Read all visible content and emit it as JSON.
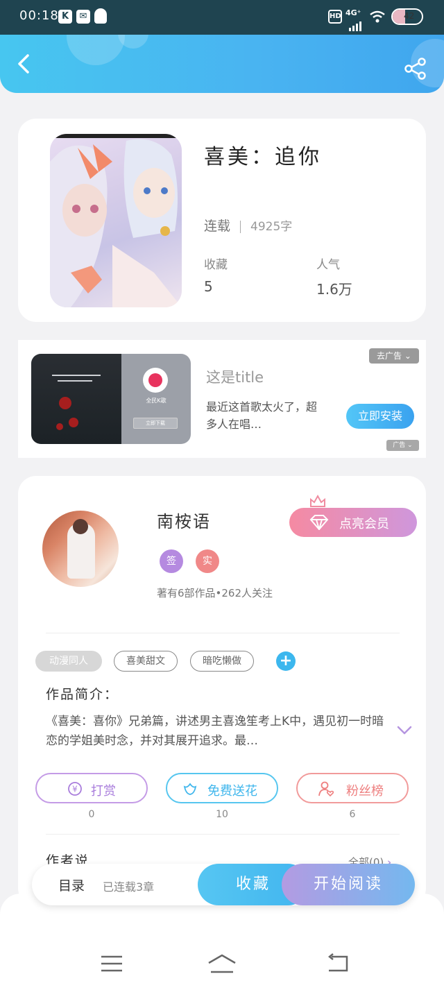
{
  "status_bar": {
    "time": "00:18",
    "network": "4G⁺",
    "hd": "HD",
    "battery": "42",
    "app_icons": [
      "K",
      "✉"
    ]
  },
  "header": {
    "back_icon": "chevron-left-icon",
    "share_icon": "share-icon"
  },
  "book": {
    "title": "喜美：追你",
    "status": "连载",
    "word_count": "4925字",
    "collect_label": "收藏",
    "collect_value": "5",
    "popularity_label": "人气",
    "popularity_value": "1.6万"
  },
  "ad": {
    "app_name": "全民K歌",
    "download_label": "立即下载",
    "title": "这是title",
    "desc": "最近这首歌太火了，超多人在唱…",
    "install_label": "立即安装",
    "close_label": "去广告",
    "mark_label": "广告"
  },
  "author": {
    "name": "南桉语",
    "badges": [
      "签",
      "实"
    ],
    "works_info": "著有6部作品•262人关注",
    "vip_label": "点亮会员"
  },
  "tags": [
    "动漫同人",
    "喜美甜文",
    "暗吃懒做"
  ],
  "intro": {
    "heading": "作品简介：",
    "text": "《喜美：喜你》兄弟篇，讲述男主喜逸笙考上K中，遇见初一时暗恋的学姐美时念，并对其展开追求。最…"
  },
  "actions": [
    {
      "label": "打赏",
      "count": "0"
    },
    {
      "label": "免费送花",
      "count": "10"
    },
    {
      "label": "粉丝榜",
      "count": "6"
    }
  ],
  "author_says": {
    "heading": "作者说",
    "all_label": "全部(0)"
  },
  "bottom_bar": {
    "toc": "目录",
    "serial": "已连载3章",
    "collect": "收藏",
    "read": "开始阅读"
  },
  "colors": {
    "accent_blue": "#47c6f0",
    "vip_pink": "#f58aa2",
    "purple": "#b79be6",
    "red": "#f08888"
  }
}
